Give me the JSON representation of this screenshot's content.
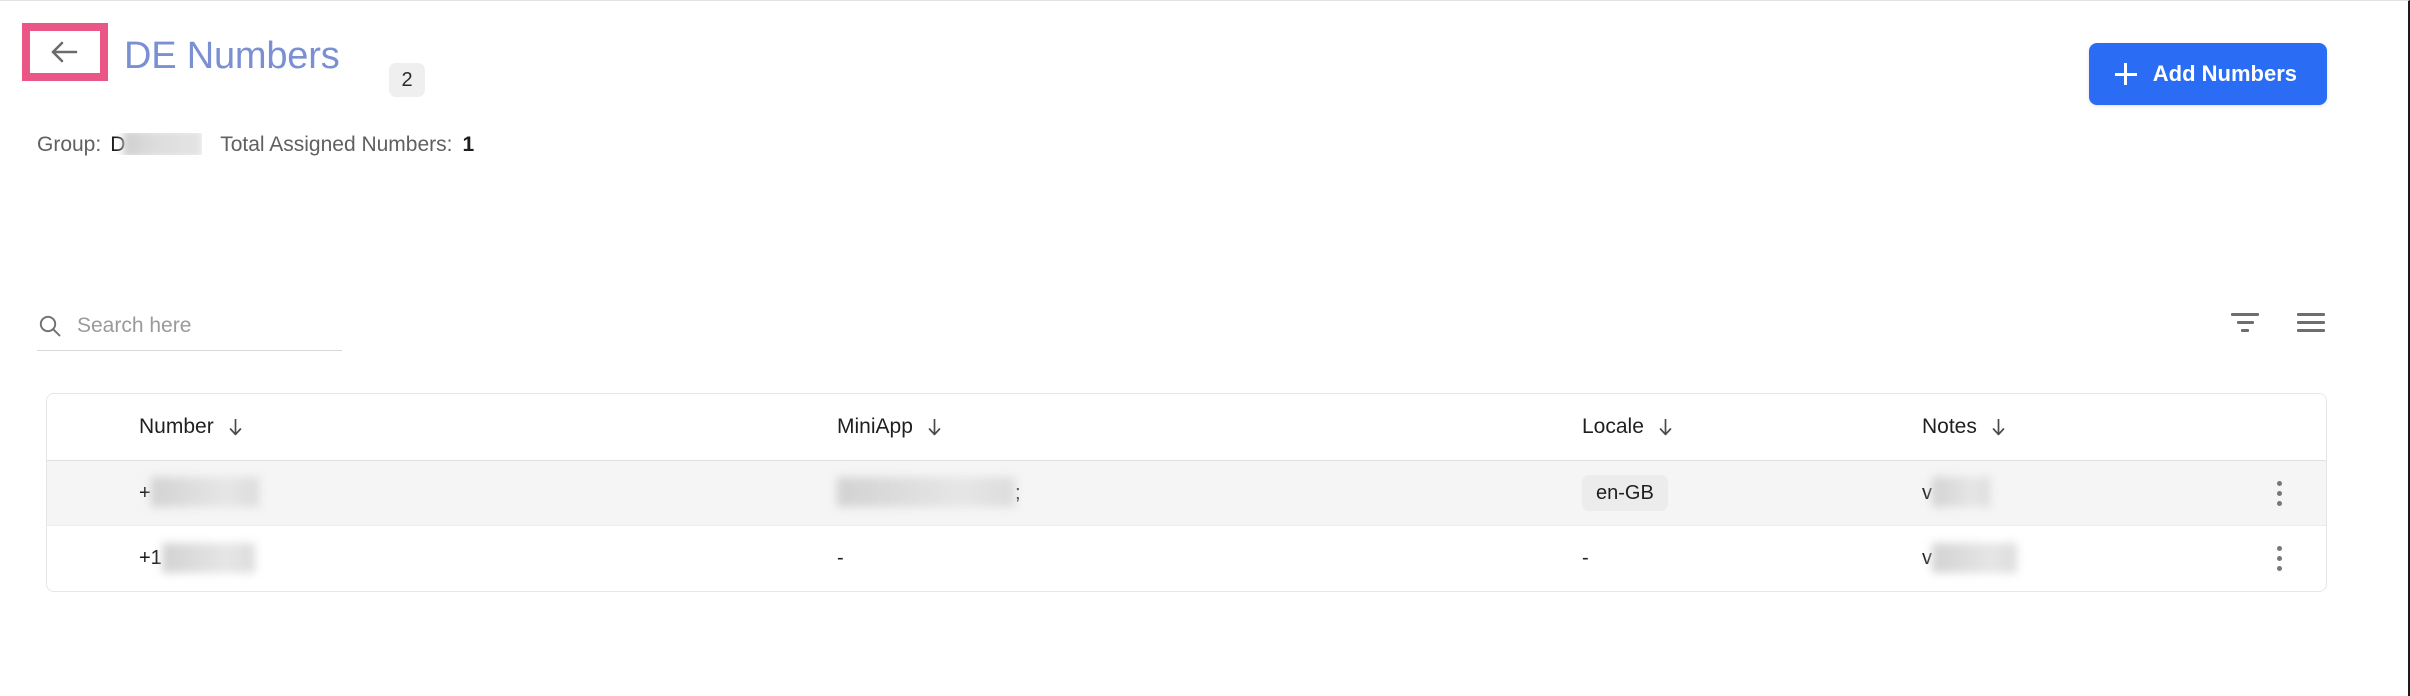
{
  "header": {
    "back_icon": "arrow-left-icon",
    "title": "DE Numbers",
    "count_badge": "2",
    "add_button_label": "Add Numbers",
    "add_button_icon": "plus-icon",
    "highlight_color": "#ea5685",
    "accent_color": "#2a6df4",
    "title_color": "#7b90d3"
  },
  "meta": {
    "group_label": "Group:",
    "group_value": "D",
    "total_label": "Total Assigned Numbers:",
    "total_value": "1"
  },
  "search": {
    "placeholder": "Search here",
    "value": "",
    "icon": "search-icon"
  },
  "tools": [
    {
      "name": "filter-icon",
      "label": "Filter"
    },
    {
      "name": "list-view-icon",
      "label": "List options"
    }
  ],
  "table": {
    "columns": [
      {
        "label": "Number",
        "sort_icon": "arrow-down-icon"
      },
      {
        "label": "MiniApp",
        "sort_icon": "arrow-down-icon"
      },
      {
        "label": "Locale",
        "sort_icon": "arrow-down-icon"
      },
      {
        "label": "Notes",
        "sort_icon": "arrow-down-icon"
      }
    ],
    "rows": [
      {
        "number_prefix": "+",
        "number_redacted": true,
        "number_redacted_width": 108,
        "miniapp": "",
        "miniapp_redacted": true,
        "miniapp_redacted_width": 178,
        "miniapp_suffix": ";",
        "locale": "en-GB",
        "locale_is_chip": true,
        "notes_prefix": "v",
        "notes_redacted": true,
        "notes_redacted_width": 58,
        "actions_icon": "kebab-menu-icon"
      },
      {
        "number_prefix": "+1",
        "number_redacted": true,
        "number_redacted_width": 93,
        "miniapp": "-",
        "miniapp_redacted": false,
        "locale": "-",
        "locale_is_chip": false,
        "notes_prefix": "v",
        "notes_redacted": true,
        "notes_redacted_width": 85,
        "actions_icon": "kebab-menu-icon"
      }
    ]
  }
}
